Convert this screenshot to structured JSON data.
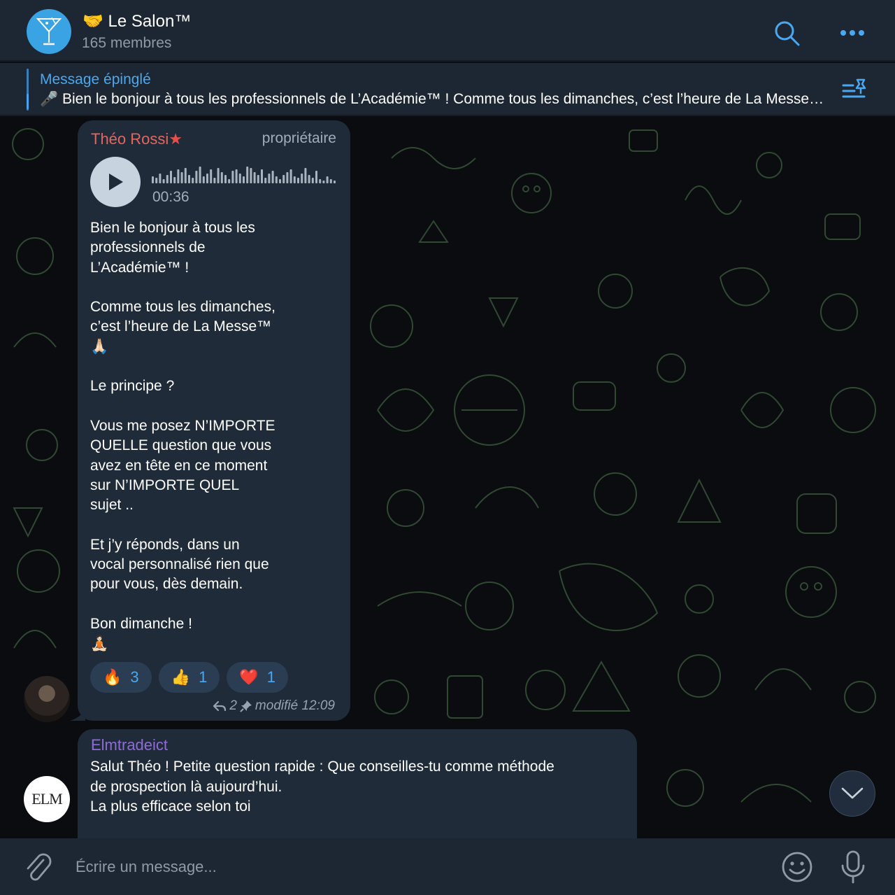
{
  "header": {
    "title": "🤝 Le Salon™",
    "subtitle": "165 membres"
  },
  "pinned": {
    "label": "Message épinglé",
    "text": "🎤 Bien le bonjour à tous les professionnels de L’Académie™ !  Comme tous les dimanches, c’est l’heure de La Messe™ 🙏"
  },
  "messages": [
    {
      "sender": "Théo Rossi",
      "role": "propriétaire",
      "voice_duration": "00:36",
      "text": "Bien le bonjour à tous les\nprofessionnels de\nL’Académie™ !\n\nComme tous les dimanches,\nc’est l’heure de La Messe™\n🙏🏻\n\nLe principe ?\n\nVous me posez N’IMPORTE\nQUELLE question que vous\navez en tête en ce moment\nsur N’IMPORTE QUEL\nsujet ..\n\nEt j’y réponds, dans un\nvocal personnalisé rien que\npour vous, dès demain.\n\nBon dimanche !\n🧘🏻",
      "reactions": [
        {
          "emoji": "🔥",
          "count": "3"
        },
        {
          "emoji": "👍",
          "count": "1"
        },
        {
          "emoji": "❤️",
          "count": "1"
        }
      ],
      "replies": "2",
      "meta": "modifié 12:09"
    },
    {
      "sender": "Elmtradeict",
      "avatar_text": "ELM",
      "text": "Salut Théo ! Petite question rapide : Que conseilles-tu comme méthode\nde prospection là aujourd’hui.\nLa plus efficace selon toi"
    }
  ],
  "composer": {
    "placeholder": "Écrire un message..."
  },
  "colors": {
    "accent": "#4aa8f0",
    "header_bg": "#1d2733",
    "bubble_bg": "#1f2b39",
    "sender_1": "#e4665e",
    "sender_2": "#8f6cd9"
  },
  "icons": [
    "group-avatar-icon",
    "search-icon",
    "more-icon",
    "pinned-list-icon",
    "play-icon",
    "reply-icon",
    "pin-icon",
    "chevron-down-icon",
    "attach-icon",
    "emoji-icon",
    "mic-icon"
  ]
}
